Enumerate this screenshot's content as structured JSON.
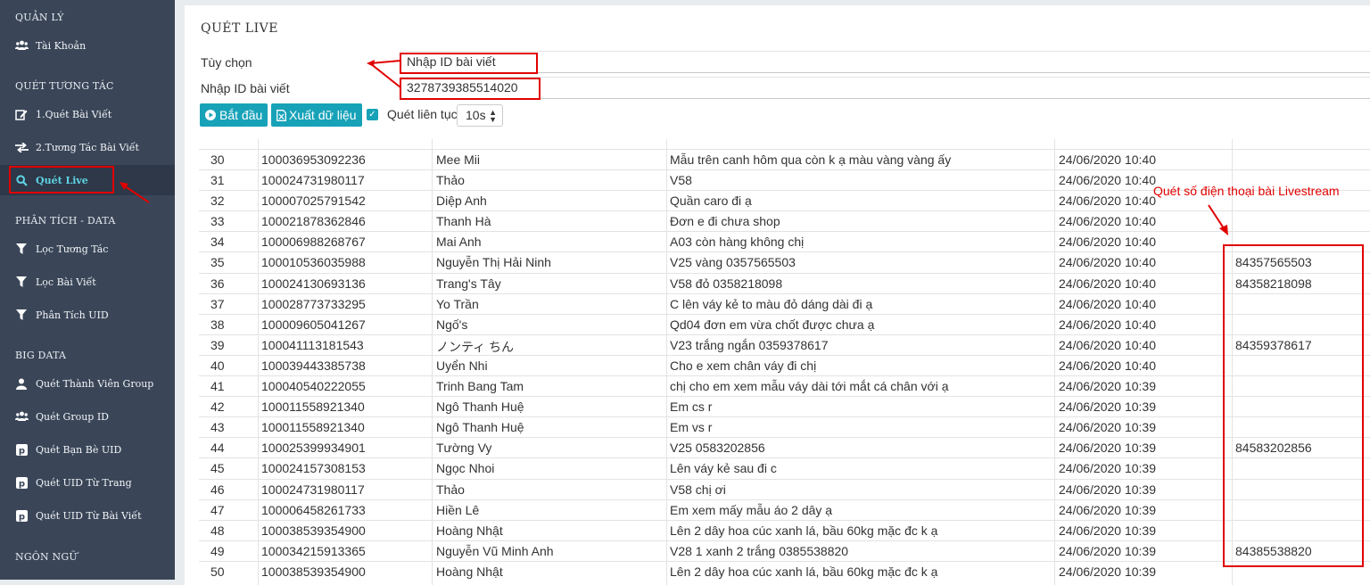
{
  "sidebar": {
    "sections": [
      {
        "heading": "QUẢN LÝ",
        "items": [
          {
            "label": "Tài Khoản",
            "icon": "users-icon"
          }
        ]
      },
      {
        "heading": "QUÉT TƯƠNG TÁC",
        "items": [
          {
            "label": "1.Quét Bài Viết",
            "icon": "edit-icon"
          },
          {
            "label": "2.Tương Tác Bài Viết",
            "icon": "exchange-icon"
          },
          {
            "label": "Quét Live",
            "icon": "search-icon",
            "active": true
          }
        ]
      },
      {
        "heading": "PHÂN TÍCH - DATA",
        "items": [
          {
            "label": "Lọc Tương Tác",
            "icon": "filter-icon"
          },
          {
            "label": "Lọc Bài Viết",
            "icon": "filter-icon"
          },
          {
            "label": "Phân Tích UID",
            "icon": "filter-icon"
          }
        ]
      },
      {
        "heading": "BIG DATA",
        "items": [
          {
            "label": "Quét Thành Viên Group",
            "icon": "user-icon"
          },
          {
            "label": "Quét Group ID",
            "icon": "users-icon"
          },
          {
            "label": "Quét Bạn Bè UID",
            "icon": "pinterest-icon"
          },
          {
            "label": "Quét UID Từ Trang",
            "icon": "pinterest-icon"
          },
          {
            "label": "Quét UID Từ Bài Viết",
            "icon": "pinterest-icon"
          }
        ]
      },
      {
        "heading": "NGÔN NGỮ",
        "items": []
      }
    ]
  },
  "main": {
    "title": "QUÉT LIVE",
    "option_label": "Tùy chọn",
    "option_value": "Nhập ID bài viết",
    "post_id_label": "Nhập ID bài viết",
    "post_id_value": "3278739385514020",
    "start_button": "Bắt đầu",
    "export_button": "Xuất dữ liệu",
    "continuous_label": "Quét liên tục",
    "interval_value": "10s",
    "annotation": "Quét số điện thoại bài Livestream"
  },
  "table": {
    "rows": [
      [
        "30",
        "100036953092236",
        "Mee Mii",
        "Mẫu trên canh hôm qua còn k ạ màu vàng vàng ấy",
        "24/06/2020 10:40",
        ""
      ],
      [
        "31",
        "100024731980117",
        "Thảo",
        "V58",
        "24/06/2020 10:40",
        ""
      ],
      [
        "32",
        "100007025791542",
        "Diệp Anh",
        "Quần caro đi ạ",
        "24/06/2020 10:40",
        ""
      ],
      [
        "33",
        "100021878362846",
        "Thanh Hà",
        "Đơn e đi chưa shop",
        "24/06/2020 10:40",
        ""
      ],
      [
        "34",
        "100006988268767",
        "Mai Anh",
        "A03 còn hàng không chị",
        "24/06/2020 10:40",
        ""
      ],
      [
        "35",
        "100010536035988",
        "Nguyễn Thị Hải Ninh",
        "V25 vàng 0357565503",
        "24/06/2020 10:40",
        "84357565503"
      ],
      [
        "36",
        "100024130693136",
        "Trang's Tây",
        "V58 đỏ 0358218098",
        "24/06/2020 10:40",
        "84358218098"
      ],
      [
        "37",
        "100028773733295",
        "Yo Trần",
        "C lên váy kẻ to màu đỏ dáng dài đi ạ",
        "24/06/2020 10:40",
        ""
      ],
      [
        "38",
        "100009605041267",
        "Ngố's",
        "Qd04 đơn em vừa chốt được chưa ạ",
        "24/06/2020 10:40",
        ""
      ],
      [
        "39",
        "100041113181543",
        "ノンティ ちん",
        "V23 trắng ngắn 0359378617",
        "24/06/2020 10:40",
        "84359378617"
      ],
      [
        "40",
        "100039443385738",
        "Uyển Nhi",
        "Cho e xem chân váy đi chị",
        "24/06/2020 10:40",
        ""
      ],
      [
        "41",
        "100040540222055",
        "Trinh Bang Tam",
        "chị cho em xem mẫu váy dài tới mắt cá chân với ạ",
        "24/06/2020 10:39",
        ""
      ],
      [
        "42",
        "100011558921340",
        "Ngô Thanh Huệ",
        "Em cs r",
        "24/06/2020 10:39",
        ""
      ],
      [
        "43",
        "100011558921340",
        "Ngô Thanh Huệ",
        "Em vs r",
        "24/06/2020 10:39",
        ""
      ],
      [
        "44",
        "100025399934901",
        "Tường Vy",
        "V25 0583202856",
        "24/06/2020 10:39",
        "84583202856"
      ],
      [
        "45",
        "100024157308153",
        "Ngọc Nhoi",
        "Lên váy kẻ sau đi c",
        "24/06/2020 10:39",
        ""
      ],
      [
        "46",
        "100024731980117",
        "Thảo",
        "V58 chị ơi",
        "24/06/2020 10:39",
        ""
      ],
      [
        "47",
        "100006458261733",
        "Hiền Lê",
        "Em xem mấy mẫu áo 2 dây ạ",
        "24/06/2020 10:39",
        ""
      ],
      [
        "48",
        "100038539354900",
        "Hoàng Nhật",
        "Lên 2 dây hoa cúc xanh lá, bầu 60kg mặc đc k ạ",
        "24/06/2020 10:39",
        ""
      ],
      [
        "49",
        "100034215913365",
        "Nguyễn Vũ Minh Anh",
        "V28 1 xanh 2 trắng 0385538820",
        "24/06/2020 10:39",
        "84385538820"
      ],
      [
        "50",
        "100038539354900",
        "Hoàng Nhật",
        "Lên 2 dây hoa cúc xanh lá, bầu 60kg mặc đc k ạ",
        "24/06/2020 10:39",
        ""
      ]
    ]
  }
}
